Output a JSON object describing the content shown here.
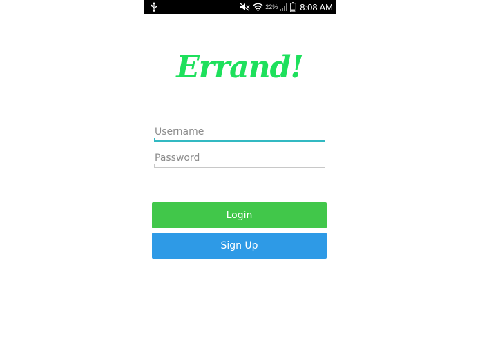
{
  "status_bar": {
    "battery_percent": "22%",
    "time": "8:08 AM",
    "icons": [
      "usb-icon",
      "mute-icon",
      "wifi-icon",
      "signal-icon",
      "battery-icon"
    ]
  },
  "app": {
    "logo_text": "Errand!",
    "brand_color": "#1ee05c"
  },
  "form": {
    "username": {
      "value": "",
      "placeholder": "Username"
    },
    "password": {
      "value": "",
      "placeholder": "Password"
    }
  },
  "buttons": {
    "login_label": "Login",
    "login_color": "#41c74a",
    "signup_label": "Sign Up",
    "signup_color": "#2e9ae6"
  }
}
